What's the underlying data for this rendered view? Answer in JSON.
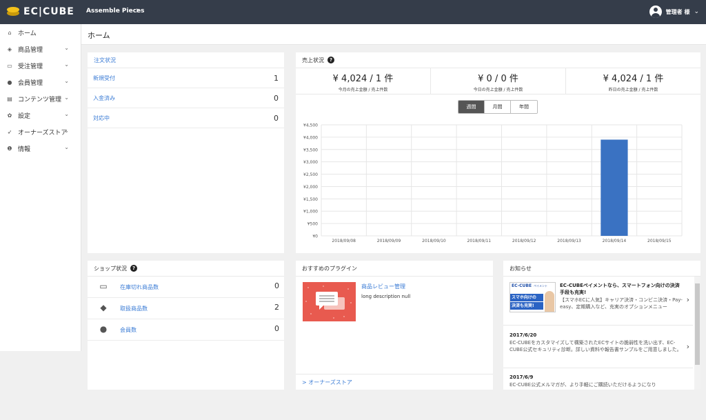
{
  "header": {
    "logo_text": "EC|CUBE",
    "shop_name": "Assemble Pieces",
    "user_name": "管理者 様"
  },
  "sidebar": {
    "items": [
      {
        "label": "ホーム",
        "icon": "home-icon",
        "glyph": "⌂",
        "has_chevron": false
      },
      {
        "label": "商品管理",
        "icon": "cube-icon",
        "glyph": "◈",
        "has_chevron": true
      },
      {
        "label": "受注管理",
        "icon": "cart-icon",
        "glyph": "▭",
        "has_chevron": true
      },
      {
        "label": "会員管理",
        "icon": "users-icon",
        "glyph": "●",
        "has_chevron": true
      },
      {
        "label": "コンテンツ管理",
        "icon": "file-icon",
        "glyph": "▤",
        "has_chevron": true
      },
      {
        "label": "設定",
        "icon": "gear-icon",
        "glyph": "✿",
        "has_chevron": true
      },
      {
        "label": "オーナーズストア",
        "icon": "plug-icon",
        "glyph": "➶",
        "has_chevron": true
      },
      {
        "label": "情報",
        "icon": "info-icon",
        "glyph": "❶",
        "has_chevron": true
      }
    ]
  },
  "page": {
    "title": "ホーム"
  },
  "orders": {
    "title": "注文状況",
    "rows": [
      {
        "label": "新規受付",
        "value": "1"
      },
      {
        "label": "入金済み",
        "value": "0"
      },
      {
        "label": "対応中",
        "value": "0"
      }
    ]
  },
  "sales": {
    "title": "売上状況",
    "kpis": [
      {
        "value": "¥ 4,024 / 1 件",
        "label": "今月の売上金額 / 売上件数"
      },
      {
        "value": "¥ 0 / 0 件",
        "label": "今日の売上金額 / 売上件数"
      },
      {
        "value": "¥ 4,024 / 1 件",
        "label": "昨日の売上金額 / 売上件数"
      }
    ],
    "toggle": [
      "週間",
      "月間",
      "年間"
    ]
  },
  "chart_data": {
    "type": "bar",
    "categories": [
      "2018/09/08",
      "2018/09/09",
      "2018/09/10",
      "2018/09/11",
      "2018/09/12",
      "2018/09/13",
      "2018/09/14",
      "2018/09/15"
    ],
    "values": [
      0,
      0,
      0,
      0,
      0,
      0,
      3900,
      0
    ],
    "ylim": [
      0,
      4500
    ],
    "yticks": [
      "¥0",
      "¥500",
      "¥1,000",
      "¥1,500",
      "¥2,000",
      "¥2,500",
      "¥3,000",
      "¥3,500",
      "¥4,000",
      "¥4,500"
    ],
    "bar_color": "#3a72c2",
    "grid": true
  },
  "shop": {
    "title": "ショップ状況",
    "rows": [
      {
        "label": "在庫切れ商品数",
        "value": "0",
        "icon": "inbox-icon",
        "glyph": "▭"
      },
      {
        "label": "取扱商品数",
        "value": "2",
        "icon": "cubes-icon",
        "glyph": "◆"
      },
      {
        "label": "会員数",
        "value": "0",
        "icon": "users-icon",
        "glyph": "●"
      }
    ]
  },
  "plugins": {
    "title": "おすすめのプラグイン",
    "item_title": "商品レビュー管理",
    "item_desc": "long description null",
    "footer": "> オーナーズストア"
  },
  "news": {
    "title": "お知らせ",
    "items": [
      {
        "title": "EC-CUBEペイメントなら、スマートフォン向けの決済手段も充実!",
        "body": "【スマホECに人気】キャリア決済・コンビニ決済・Pay-easy、定期購入など、充実のオプションメニュー",
        "banner_top": "EC-CUBE",
        "banner_sub": "ペイメント",
        "banner_text1": "スマホ向けの",
        "banner_text2": "決済も充実!"
      },
      {
        "date": "2017/6/20",
        "body": "EC-CUBEをカスタマイズして構築されたECサイトの脆弱性を洗い出す、EC-CUBE公式セキュリティ診断。詳しい資料や報告書サンプルをご用意しました。"
      },
      {
        "date": "2017/6/9",
        "body": "EC-CUBE公式メルマガが、より手軽にご購読いただけるようになり"
      }
    ]
  }
}
